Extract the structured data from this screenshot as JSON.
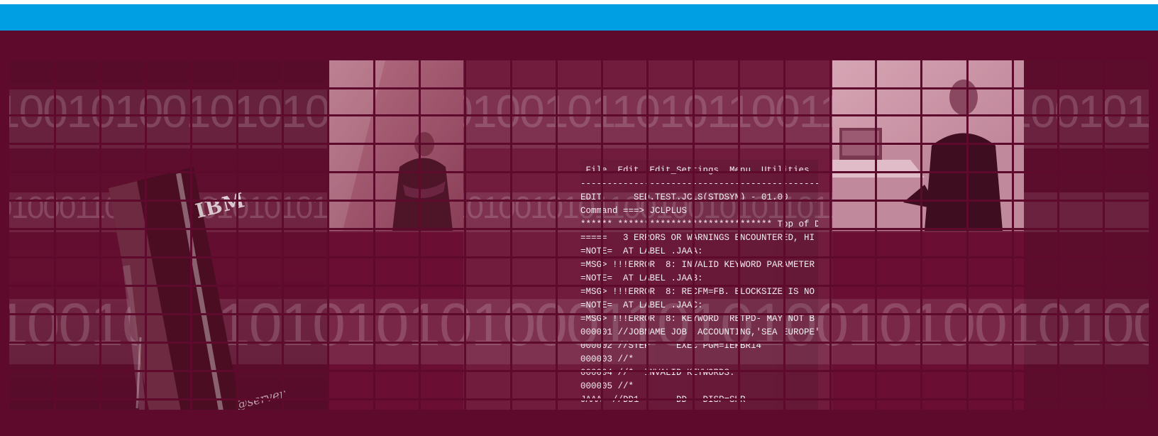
{
  "colors": {
    "top_bar": "#009fe3",
    "banner_background": "#5e0a2c",
    "panel": "#6a0f33",
    "grid_lines": "#5e0a2c"
  },
  "binary_text": {
    "row1": "1001010010101010101010010110101100110010101100101010010110101101",
    "row2": "0100011010010010101011010100110100101011001001010110110011001010",
    "row3": "1001010101010101000110101001010010100101010101010010101010010101"
  },
  "server_logo": {
    "brand": "IBM",
    "label": "@server"
  },
  "terminal": {
    "lines": [
      " File  Edit  Edit_Settings  Menu  Utilities",
      "---------------------------------------------",
      "EDIT      SED.TEST.JCLS(STDSYN) - 01.00",
      "Command ===> JCLPLUS",
      "****** ***************************** Top of D",
      "=====   3 ERRORS OR WARNINGS ENCOUNTERED, HI",
      "=NOTE=  AT LABEL .JAAA:",
      "=MSG> !!!ERROR  8: INVALID KEYWORD PARAMETER",
      "=NOTE=  AT LABEL .JAAB:",
      "=MSG> !!!ERROR  8: RECFM=FB. BLOCKSIZE IS NO",
      "=NOTE=  AT LABEL .JAAC:",
      "=MSG> !!!ERROR  8: KEYWORD  RETPD- MAY NOT B",
      "000001 //JOBNAME JOB  ACCOUNTING,'SEA EUROPE'",
      "000002 //STEP     EXEC PGM=IEFBR14",
      "000003 //*",
      "000004 //*  INVALID KEYWORDS:",
      "000005 //*",
      "JAAA  //DD1       DD   DISP=SHR"
    ]
  }
}
